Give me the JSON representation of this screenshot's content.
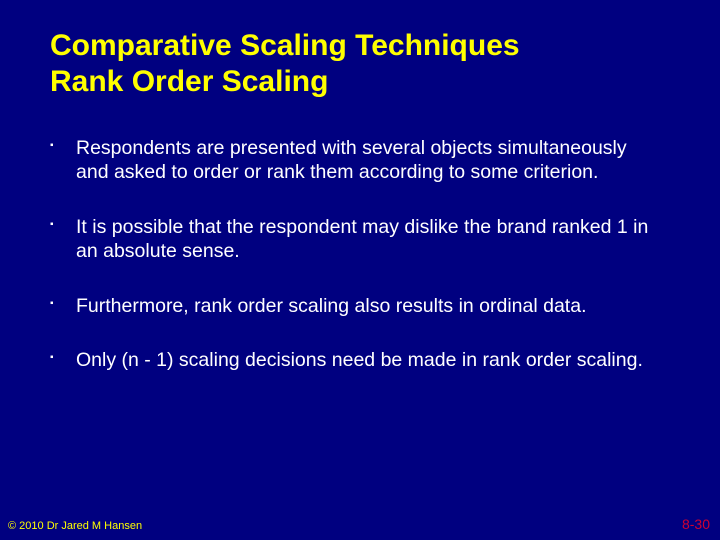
{
  "title_line1": "Comparative Scaling Techniques",
  "title_line2": "Rank Order Scaling",
  "bullets": [
    "Respondents are presented with several objects simultaneously and asked to order or rank them according to some criterion.",
    "It is possible that the respondent may dislike the brand ranked 1 in an absolute sense.",
    "Furthermore, rank order scaling also results in ordinal data.",
    "Only (n - 1) scaling decisions need be made in rank order scaling."
  ],
  "footer_left": "© 2010 Dr Jared M Hansen",
  "footer_right": "8-30"
}
